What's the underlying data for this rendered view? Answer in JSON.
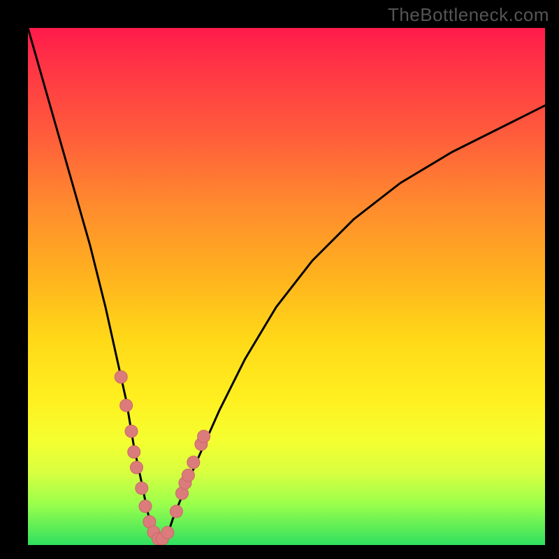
{
  "watermark": "TheBottleneck.com",
  "chart_data": {
    "type": "line",
    "title": "",
    "xlabel": "",
    "ylabel": "",
    "xlim": [
      0,
      100
    ],
    "ylim": [
      0,
      100
    ],
    "series": [
      {
        "name": "curve",
        "x": [
          0,
          4,
          8,
          12,
          15,
          17,
          19,
          20.5,
          22,
          23,
          24,
          25,
          26,
          27,
          28,
          30,
          33,
          37,
          42,
          48,
          55,
          63,
          72,
          82,
          92,
          100
        ],
        "y": [
          100,
          86,
          72,
          58,
          46,
          37,
          28,
          19,
          12,
          7,
          3,
          1,
          1,
          2,
          5,
          10,
          17,
          26,
          36,
          46,
          55,
          63,
          70,
          76,
          81,
          85
        ]
      }
    ],
    "highlight_points": {
      "name": "markers",
      "x": [
        18.0,
        19.0,
        20.0,
        20.5,
        21.0,
        22.0,
        22.7,
        23.5,
        24.3,
        25.2,
        26.0,
        27.0,
        28.7,
        29.8,
        30.4,
        31.0,
        32.0,
        33.5,
        34.0
      ],
      "y": [
        32.5,
        27.0,
        22.0,
        18.0,
        15.0,
        11.0,
        7.5,
        4.5,
        2.5,
        1.2,
        1.2,
        2.4,
        6.5,
        10.0,
        12.0,
        13.5,
        16.0,
        19.5,
        21.0
      ]
    },
    "colors": {
      "curve": "#000000",
      "marker_fill": "#db7b7b",
      "marker_stroke": "#c96868"
    }
  }
}
